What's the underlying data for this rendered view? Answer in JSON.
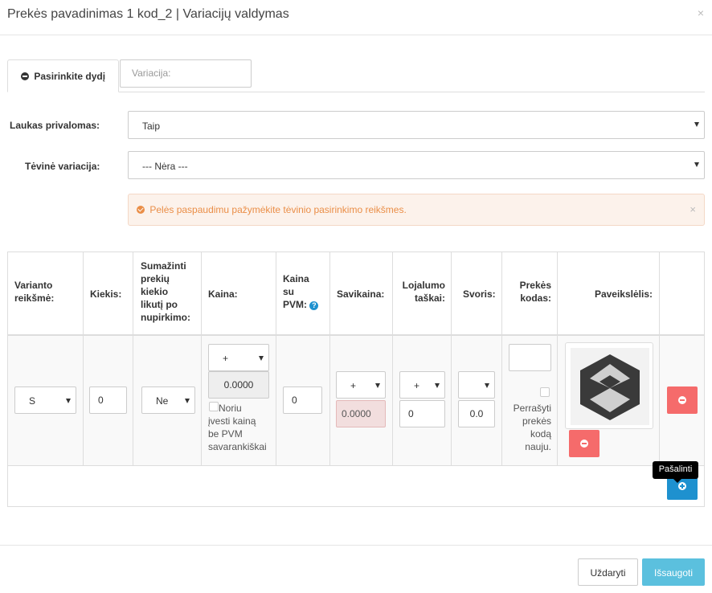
{
  "header": {
    "title": "Prekės pavadinimas 1 kod_2 | Variacijų valdymas",
    "close_symbol": "×"
  },
  "tabs": {
    "active_label": "Pasirinkite dydį",
    "active_icon": "minus-circle-icon",
    "variation_placeholder": "Variacija:"
  },
  "form": {
    "required_label": "Laukas privalomas:",
    "required_value": "Taip",
    "parent_label": "Tėvinė variacija:",
    "parent_value": "--- Nėra ---"
  },
  "alert": {
    "icon": "check-circle-icon",
    "text": "Pelės paspaudimu pažymėkite tėvinio pasirinkimo reikšmes.",
    "close_symbol": "×"
  },
  "table": {
    "headers": {
      "variant_value": [
        "Varianto",
        "reikšmė:"
      ],
      "quantity": [
        "Kiekis:"
      ],
      "reduce_stock": [
        "Sumažinti",
        "prekių",
        "kiekio",
        "likutį po",
        "nupirkimo:"
      ],
      "price": [
        "Kaina:"
      ],
      "price_vat": [
        "Kaina",
        "su",
        "PVM:"
      ],
      "cost": [
        "Savikaina:"
      ],
      "loyalty": [
        "Lojalumo",
        "taškai:"
      ],
      "weight": [
        "Svoris:"
      ],
      "product_code": [
        "Prekės",
        "kodas:"
      ],
      "image": [
        "Paveikslėlis:"
      ]
    },
    "row": {
      "variant_value": "S",
      "quantity": "0",
      "reduce_stock": "Ne",
      "price_prefix": "+",
      "price_value": "0.0000",
      "price_checkbox_label": [
        "Noriu",
        "įvesti kainą",
        "be PVM",
        "savarankiškai"
      ],
      "price_vat_value": "0",
      "cost_prefix": "+",
      "cost_value": "0.0000",
      "loyalty_prefix": "+",
      "loyalty_value": "0",
      "weight_prefix": "",
      "weight_value": "0.0",
      "product_code_value": "",
      "overwrite_label": [
        "Perrašyti",
        "prekės",
        "kodą",
        "nauju."
      ]
    },
    "remove_tooltip": "Pašalinti",
    "help_icon": "question-circle-icon",
    "help_symbol": "?"
  },
  "footer": {
    "close_label": "Uždaryti",
    "save_label": "Išsaugoti"
  },
  "colors": {
    "alert_text": "#ea8e47",
    "alert_bg": "#fcf2eb",
    "danger": "#f56b6b",
    "primary": "#1e91cf",
    "info": "#5bc0de",
    "error_input_bg": "#f2dede"
  }
}
